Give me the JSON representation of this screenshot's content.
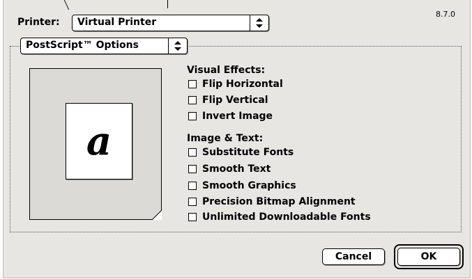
{
  "dialog": {
    "version": "8.7.0",
    "printer_label": "Printer:",
    "printer_value": "Virtual Printer",
    "panel_value": "PostScript™ Options"
  },
  "preview": {
    "glyph": "a"
  },
  "visual_effects": {
    "heading": "Visual Effects:",
    "items": [
      {
        "label": "Flip Horizontal",
        "checked": false
      },
      {
        "label": "Flip Vertical",
        "checked": false
      },
      {
        "label": "Invert Image",
        "checked": false
      }
    ]
  },
  "image_text": {
    "heading": "Image & Text:",
    "items": [
      {
        "label": "Substitute Fonts",
        "checked": false
      },
      {
        "label": "Smooth Text",
        "checked": false
      },
      {
        "label": "Smooth Graphics",
        "checked": false
      },
      {
        "label": "Precision Bitmap Alignment",
        "checked": false
      },
      {
        "label": "Unlimited Downloadable Fonts",
        "checked": false
      }
    ]
  },
  "buttons": {
    "cancel": "Cancel",
    "ok": "OK"
  }
}
